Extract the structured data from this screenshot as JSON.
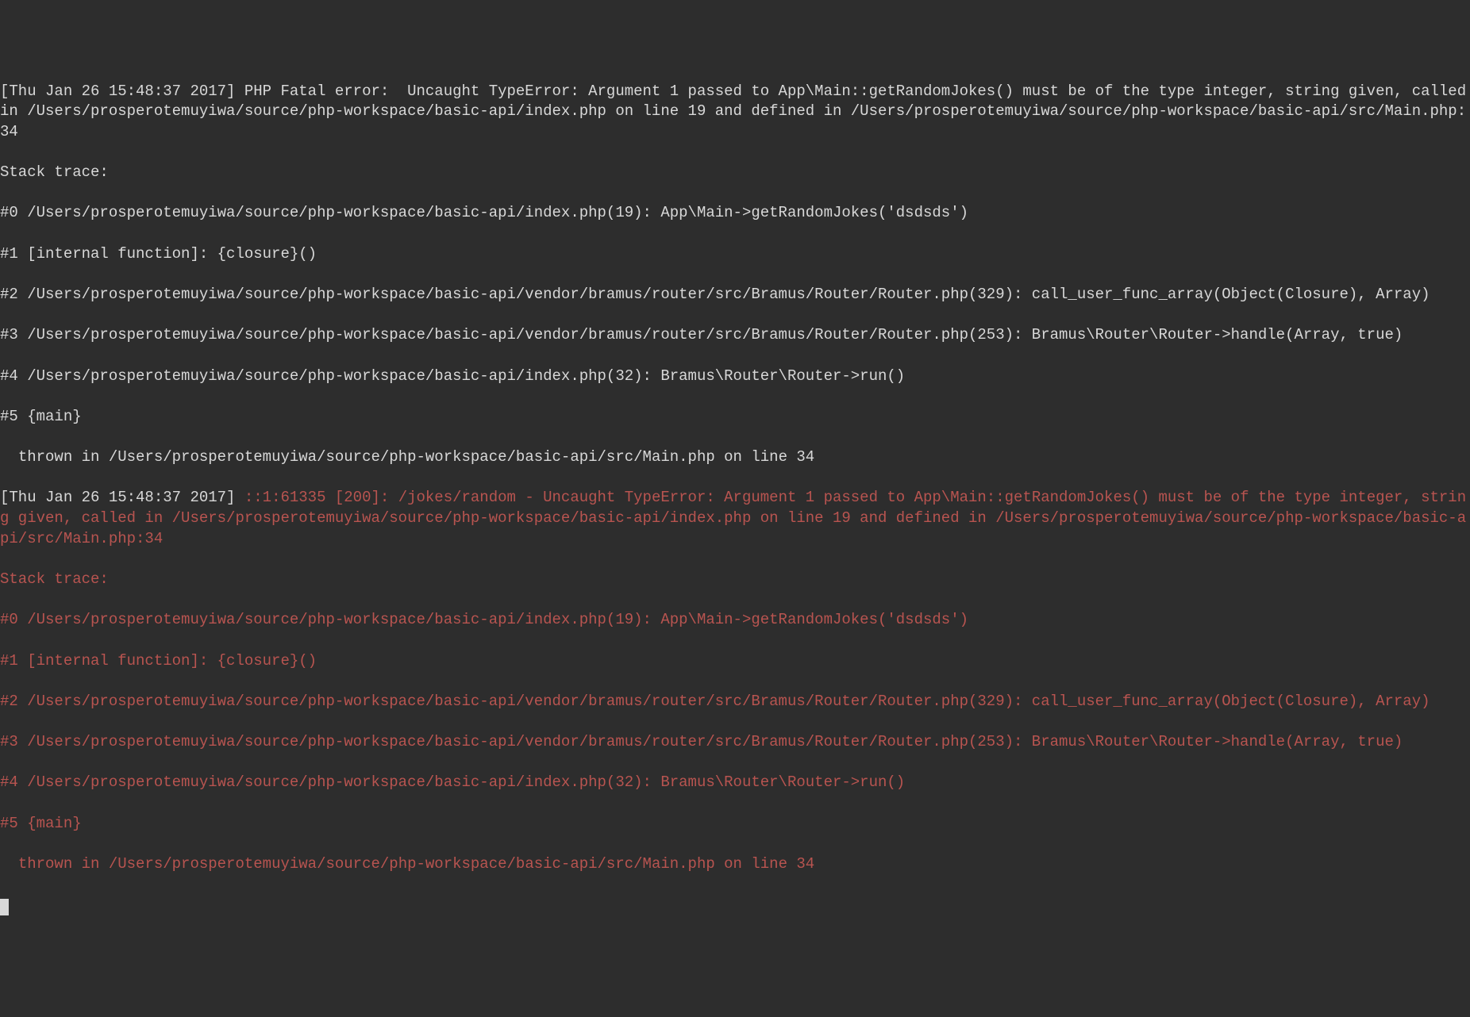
{
  "terminal": {
    "lines": [
      {
        "color": "white",
        "text": "[Thu Jan 26 15:48:37 2017] PHP Fatal error:  Uncaught TypeError: Argument 1 passed to App\\Main::getRandomJokes() must be of the type integer, string given, called in /Users/prosperotemuyiwa/source/php-workspace/basic-api/index.php on line 19 and defined in /Users/prosperotemuyiwa/source/php-workspace/basic-api/src/Main.php:34"
      },
      {
        "color": "white",
        "text": "Stack trace:"
      },
      {
        "color": "white",
        "text": "#0 /Users/prosperotemuyiwa/source/php-workspace/basic-api/index.php(19): App\\Main->getRandomJokes('dsdsds')"
      },
      {
        "color": "white",
        "text": "#1 [internal function]: {closure}()"
      },
      {
        "color": "white",
        "text": "#2 /Users/prosperotemuyiwa/source/php-workspace/basic-api/vendor/bramus/router/src/Bramus/Router/Router.php(329): call_user_func_array(Object(Closure), Array)"
      },
      {
        "color": "white",
        "text": "#3 /Users/prosperotemuyiwa/source/php-workspace/basic-api/vendor/bramus/router/src/Bramus/Router/Router.php(253): Bramus\\Router\\Router->handle(Array, true)"
      },
      {
        "color": "white",
        "text": "#4 /Users/prosperotemuyiwa/source/php-workspace/basic-api/index.php(32): Bramus\\Router\\Router->run()"
      },
      {
        "color": "white",
        "text": "#5 {main}"
      },
      {
        "color": "white",
        "text": "  thrown in /Users/prosperotemuyiwa/source/php-workspace/basic-api/src/Main.php on line 34"
      }
    ],
    "request_prefix": "[Thu Jan 26 15:48:37 2017] ",
    "request_info": "::1:61335 [200]: /jokes/random - Uncaught TypeError: Argument 1 passed to App\\Main::getRandomJokes() must be of the type integer, string given, called in /Users/prosperotemuyiwa/source/php-workspace/basic-api/index.php on line 19 and defined in /Users/prosperotemuyiwa/source/php-workspace/basic-api/src/Main.php:34",
    "red_lines": [
      {
        "text": "Stack trace:"
      },
      {
        "text": "#0 /Users/prosperotemuyiwa/source/php-workspace/basic-api/index.php(19): App\\Main->getRandomJokes('dsdsds')"
      },
      {
        "text": "#1 [internal function]: {closure}()"
      },
      {
        "text": "#2 /Users/prosperotemuyiwa/source/php-workspace/basic-api/vendor/bramus/router/src/Bramus/Router/Router.php(329): call_user_func_array(Object(Closure), Array)"
      },
      {
        "text": "#3 /Users/prosperotemuyiwa/source/php-workspace/basic-api/vendor/bramus/router/src/Bramus/Router/Router.php(253): Bramus\\Router\\Router->handle(Array, true)"
      },
      {
        "text": "#4 /Users/prosperotemuyiwa/source/php-workspace/basic-api/index.php(32): Bramus\\Router\\Router->run()"
      },
      {
        "text": "#5 {main}"
      },
      {
        "text": "  thrown in /Users/prosperotemuyiwa/source/php-workspace/basic-api/src/Main.php on line 34"
      }
    ]
  }
}
